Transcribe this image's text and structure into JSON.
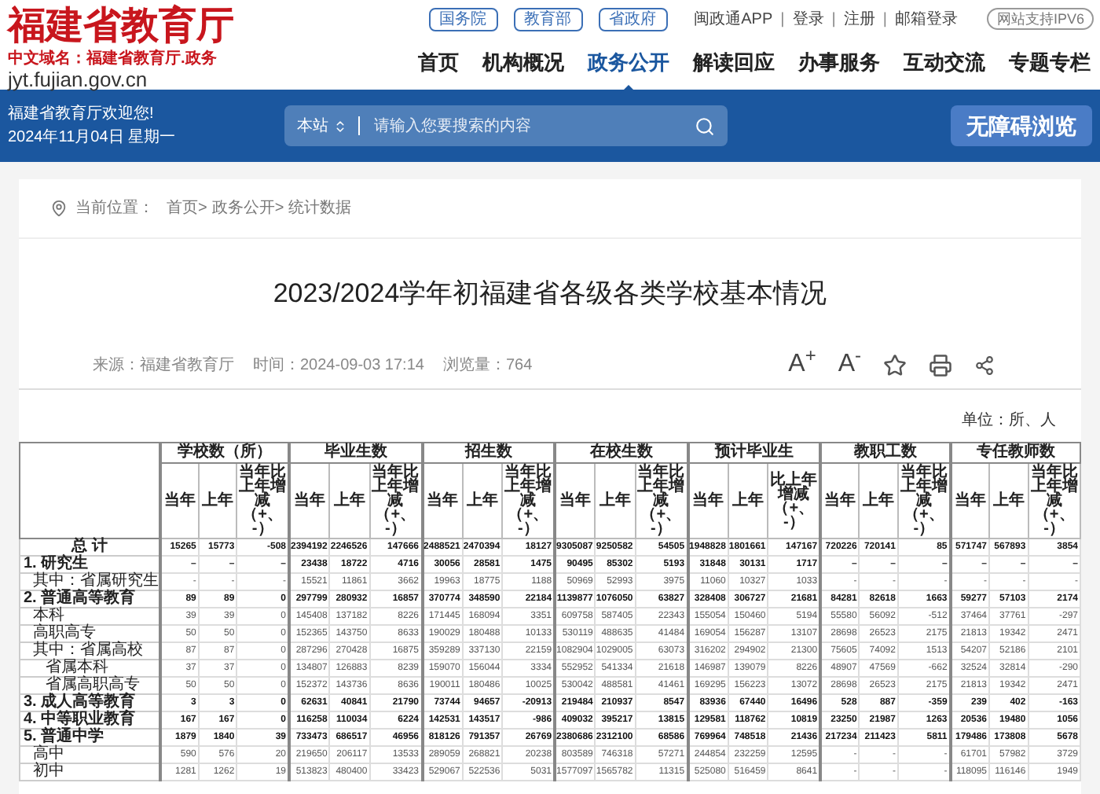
{
  "site": {
    "name": "福建省教育厅",
    "domain_cn": "中文域名：福建省教育厅.政务",
    "domain": "jyt.fujian.gov.cn"
  },
  "top_links": {
    "portals": [
      "国务院",
      "教育部",
      "省政府"
    ],
    "links": [
      {
        "label": "闽政通APP",
        "separator": "|"
      },
      {
        "label": "登录",
        "separator": "|"
      },
      {
        "label": "注册",
        "separator": "|"
      },
      {
        "label": "邮箱登录"
      }
    ],
    "badge": "网站支持IPV6"
  },
  "nav": [
    {
      "label": "首页",
      "selected": false
    },
    {
      "label": "机构概况",
      "selected": false
    },
    {
      "label": "政务公开",
      "selected": true
    },
    {
      "label": "解读回应",
      "selected": false
    },
    {
      "label": "办事服务",
      "selected": false
    },
    {
      "label": "互动交流",
      "selected": false
    },
    {
      "label": "专题专栏",
      "selected": false
    }
  ],
  "welcome": {
    "greeting": "福建省教育厅欢迎您!",
    "date": "2024年11月04日 星期一"
  },
  "search": {
    "scope": "本站",
    "placeholder": "请输入您要搜索的内容"
  },
  "accessibility_button": "无障碍浏览",
  "breadcrumb": {
    "label": "当前位置：",
    "items": [
      {
        "label": "首页",
        "separator": ">"
      },
      {
        "label": "政务公开",
        "separator": ">"
      },
      {
        "label": "统计数据"
      }
    ]
  },
  "article": {
    "title": "2023/2024学年初福建省各级各类学校基本情况",
    "meta": [
      "来源：福建省教育厅",
      "时间：2024-09-03 17:14",
      "浏览量：764"
    ],
    "tools": [
      {
        "kind": "text",
        "label": "A$^{+}$"
      },
      {
        "kind": "text",
        "label": "A$^{-}$"
      },
      {
        "kind": "star"
      },
      {
        "kind": "print"
      },
      {
        "kind": "share"
      }
    ],
    "unit": "单位：所、人",
    "table": {
      "groups": [
        {
          "title": "学校数（所）",
          "columns": [
            "当年",
            "上年",
            "当年比上年增减（+、-）"
          ]
        },
        {
          "title": "毕业生数",
          "columns": [
            "当年",
            "上年",
            "当年比上年增减（+、-）"
          ]
        },
        {
          "title": "招生数",
          "columns": [
            "当年",
            "上年",
            "当年比上年增减（+、-）"
          ]
        },
        {
          "title": "在校生数",
          "columns": [
            "当年",
            "上年",
            "当年比上年增减（+、-）"
          ]
        },
        {
          "title": "预计毕业生",
          "columns": [
            "当年",
            "上年",
            "比上年增减（+、-）"
          ]
        },
        {
          "title": "教职工数",
          "columns": [
            "当年",
            "上年",
            "当年比上年增减（+、-）"
          ]
        },
        {
          "title": "专任教师数",
          "columns": [
            "当年",
            "上年",
            "当年比上年增减（+、-）"
          ]
        }
      ],
      "rows": [
        {
          "kind": "total",
          "label": "总 计",
          "values": [
            "15265",
            "15773",
            "-508",
            "2394192",
            "2246526",
            "147666",
            "2488521",
            "2470394",
            "18127",
            "9305087",
            "9250582",
            "54505",
            "1948828",
            "1801661",
            "147167",
            "720226",
            "720141",
            "85",
            "571747",
            "567893",
            "3854"
          ]
        },
        {
          "kind": "category",
          "label": "1. 研究生",
          "values": [
            "–",
            "–",
            "–",
            "23438",
            "18722",
            "4716",
            "30056",
            "28581",
            "1475",
            "90495",
            "85302",
            "5193",
            "31848",
            "30131",
            "1717",
            "–",
            "–",
            "–",
            "–",
            "–",
            "–"
          ]
        },
        {
          "kind": "item",
          "label": "其中：省属研究生",
          "values": [
            "-",
            "-",
            "-",
            "15521",
            "11861",
            "3662",
            "19963",
            "18775",
            "1188",
            "50969",
            "52993",
            "3975",
            "11060",
            "10327",
            "1033",
            "-",
            "-",
            "-",
            "-",
            "-",
            "-"
          ]
        },
        {
          "kind": "category",
          "label": "2. 普通高等教育",
          "values": [
            "89",
            "89",
            "0",
            "297799",
            "280932",
            "16857",
            "370774",
            "348590",
            "22184",
            "1139877",
            "1076050",
            "63827",
            "328408",
            "306727",
            "21681",
            "84281",
            "82618",
            "1663",
            "59277",
            "57103",
            "2174"
          ]
        },
        {
          "kind": "item",
          "label": "本科",
          "values": [
            "39",
            "39",
            "0",
            "145408",
            "137182",
            "8226",
            "171445",
            "168094",
            "3351",
            "609758",
            "587405",
            "22343",
            "155054",
            "150460",
            "5194",
            "55580",
            "56092",
            "-512",
            "37464",
            "37761",
            "-297"
          ]
        },
        {
          "kind": "item",
          "label": "高职高专",
          "values": [
            "50",
            "50",
            "0",
            "152365",
            "143750",
            "8633",
            "190029",
            "180488",
            "10133",
            "530119",
            "488635",
            "41484",
            "169054",
            "156287",
            "13107",
            "28698",
            "26523",
            "2175",
            "21813",
            "19342",
            "2471"
          ]
        },
        {
          "kind": "item",
          "label": "其中：省属高校",
          "values": [
            "87",
            "87",
            "0",
            "287296",
            "270428",
            "16875",
            "359289",
            "337130",
            "22159",
            "1082904",
            "1029005",
            "63073",
            "316202",
            "294902",
            "21300",
            "75605",
            "74092",
            "1513",
            "54207",
            "52186",
            "2101"
          ]
        },
        {
          "kind": "subitem",
          "label": "省属本科",
          "values": [
            "37",
            "37",
            "0",
            "134807",
            "126883",
            "8239",
            "159070",
            "156044",
            "3334",
            "552952",
            "541334",
            "21618",
            "146987",
            "139079",
            "8226",
            "48907",
            "47569",
            "-662",
            "32524",
            "32814",
            "-290"
          ]
        },
        {
          "kind": "subitem",
          "label": "省属高职高专",
          "values": [
            "50",
            "50",
            "0",
            "152372",
            "143736",
            "8636",
            "190011",
            "180486",
            "10025",
            "530042",
            "488581",
            "41461",
            "169295",
            "156223",
            "13072",
            "28698",
            "26523",
            "2175",
            "21813",
            "19342",
            "2471"
          ]
        },
        {
          "kind": "category",
          "label": "3. 成人高等教育",
          "values": [
            "3",
            "3",
            "0",
            "62631",
            "40841",
            "21790",
            "73744",
            "94657",
            "-20913",
            "219484",
            "210937",
            "8547",
            "83936",
            "67440",
            "16496",
            "528",
            "887",
            "-359",
            "239",
            "402",
            "-163"
          ]
        },
        {
          "kind": "category",
          "label": "4. 中等职业教育",
          "values": [
            "167",
            "167",
            "0",
            "116258",
            "110034",
            "6224",
            "142531",
            "143517",
            "-986",
            "409032",
            "395217",
            "13815",
            "129581",
            "118762",
            "10819",
            "23250",
            "21987",
            "1263",
            "20536",
            "19480",
            "1056"
          ]
        },
        {
          "kind": "category",
          "label": "5. 普通中学",
          "values": [
            "1879",
            "1840",
            "39",
            "733473",
            "686517",
            "46956",
            "818126",
            "791357",
            "26769",
            "2380686",
            "2312100",
            "68586",
            "769964",
            "748518",
            "21436",
            "217234",
            "211423",
            "5811",
            "179486",
            "173808",
            "5678"
          ]
        },
        {
          "kind": "item",
          "label": "高中",
          "values": [
            "590",
            "576",
            "20",
            "219650",
            "206117",
            "13533",
            "289059",
            "268821",
            "20238",
            "803589",
            "746318",
            "57271",
            "244854",
            "232259",
            "12595",
            "-",
            "-",
            "-",
            "61701",
            "57982",
            "3729"
          ]
        },
        {
          "kind": "item",
          "label": "初中",
          "values": [
            "1281",
            "1262",
            "19",
            "513823",
            "480400",
            "33423",
            "529067",
            "522536",
            "5031",
            "1577097",
            "1565782",
            "11315",
            "525080",
            "516459",
            "8641",
            "-",
            "-",
            "-",
            "118095",
            "116146",
            "1949"
          ]
        }
      ]
    }
  }
}
